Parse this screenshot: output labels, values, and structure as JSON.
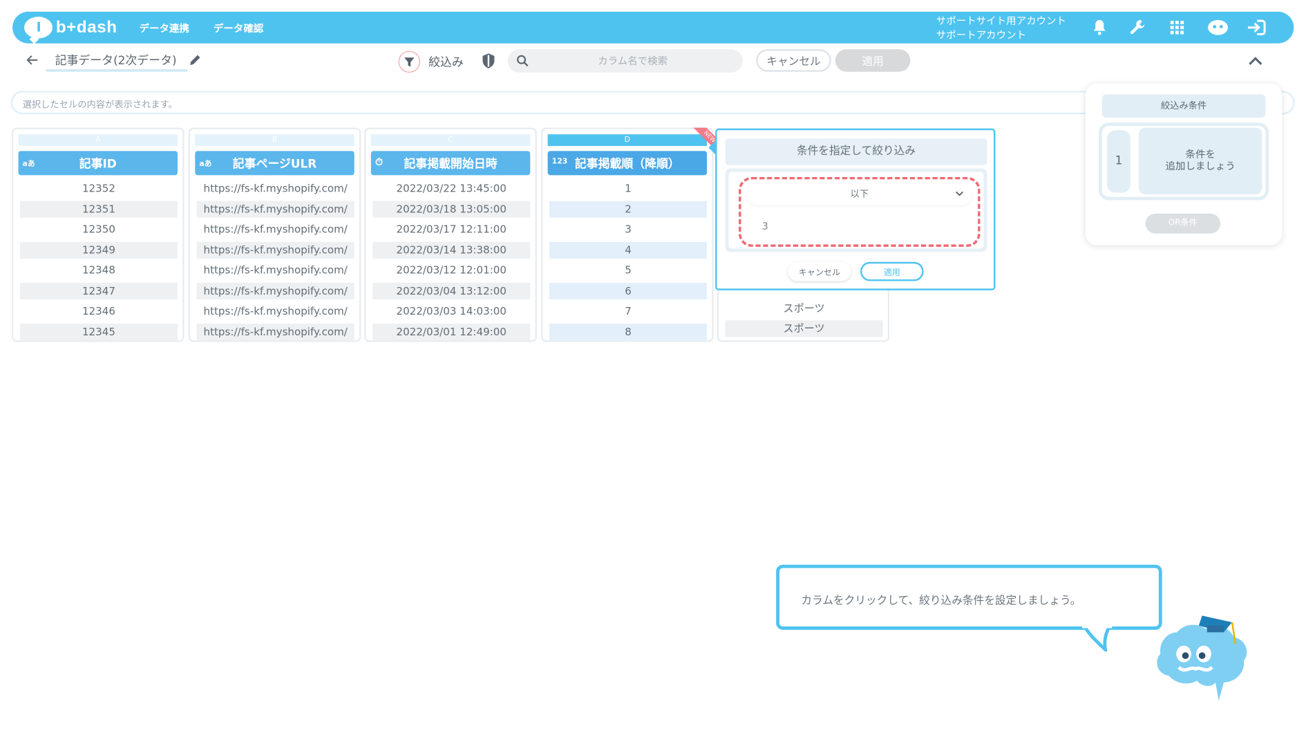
{
  "app": {
    "brand": "b+dash",
    "nav": [
      "データ連携",
      "データ確認"
    ],
    "account_line1": "サポートサイト用アカウント",
    "account_line2": "サポートアカウント",
    "icons": [
      "bell-icon",
      "wrench-icon",
      "grid-icon",
      "mascot-icon",
      "logout-icon"
    ]
  },
  "toolbar": {
    "dataset_title": "記事データ(2次データ)",
    "filter_label": "絞込み",
    "search_placeholder": "カラム名で検索",
    "cancel_label": "キャンセル",
    "apply_label": "適用"
  },
  "cellbar": {
    "placeholder": "選択したセルの内容が表示されます。"
  },
  "columns": [
    {
      "letter": "A",
      "type": "aあ",
      "name": "記事ID",
      "rows": [
        "12352",
        "12351",
        "12350",
        "12349",
        "12348",
        "12347",
        "12346",
        "12345"
      ]
    },
    {
      "letter": "B",
      "type": "aあ",
      "name": "記事ページULR",
      "rows": [
        "https://fs-kf.myshopify.com/",
        "https://fs-kf.myshopify.com/",
        "https://fs-kf.myshopify.com/",
        "https://fs-kf.myshopify.com/",
        "https://fs-kf.myshopify.com/",
        "https://fs-kf.myshopify.com/",
        "https://fs-kf.myshopify.com/",
        "https://fs-kf.myshopify.com/"
      ]
    },
    {
      "letter": "C",
      "type": "⏱",
      "name": "記事掲載開始日時",
      "rows": [
        "2022/03/22 13:45:00",
        "2022/03/18 13:05:00",
        "2022/03/17 12:11:00",
        "2022/03/14 13:38:00",
        "2022/03/12 12:01:00",
        "2022/03/04 13:12:00",
        "2022/03/03 14:03:00",
        "2022/03/01 12:49:00"
      ]
    },
    {
      "letter": "D",
      "type": "123",
      "name": "記事掲載順（降順）",
      "badge": "NEW",
      "rows": [
        "1",
        "2",
        "3",
        "4",
        "5",
        "6",
        "7",
        "8"
      ]
    }
  ],
  "column_e": {
    "rows": [
      "スポーツ",
      "スポーツ"
    ]
  },
  "filter_popup": {
    "title": "条件を指定して絞り込み",
    "operator": "以下",
    "value": "3",
    "cancel_label": "キャンセル",
    "apply_label": "適用"
  },
  "right_panel": {
    "title": "絞込み条件",
    "group_index": "1",
    "add_line1": "条件を",
    "add_line2": "追加しましょう",
    "or_label": "OR条件"
  },
  "hint": {
    "text": "カラムをクリックして、絞り込み条件を設定しましょう。"
  },
  "colors": {
    "accent": "#4fc3f0",
    "header": "#5bb6ec",
    "highlight": "#ee6b76"
  }
}
